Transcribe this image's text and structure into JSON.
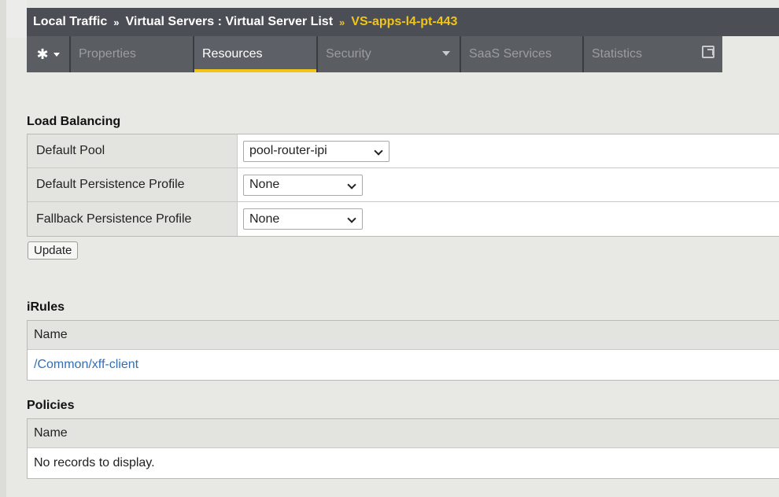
{
  "breadcrumb": {
    "level1": "Local Traffic",
    "level2": "Virtual Servers : Virtual Server List",
    "current": "VS-apps-l4-pt-443",
    "separator": "»"
  },
  "tabs": [
    {
      "label": "Properties"
    },
    {
      "label": "Resources",
      "active": true
    },
    {
      "label": "Security"
    },
    {
      "label": "SaaS Services"
    },
    {
      "label": "Statistics"
    }
  ],
  "load_balancing": {
    "title": "Load Balancing",
    "rows": [
      {
        "label": "Default Pool",
        "value": "pool-router-ipi"
      },
      {
        "label": "Default Persistence Profile",
        "value": "None"
      },
      {
        "label": "Fallback Persistence Profile",
        "value": "None"
      }
    ],
    "update_label": "Update"
  },
  "irules": {
    "title": "iRules",
    "column": "Name",
    "items": [
      "/Common/xff-client"
    ]
  },
  "policies": {
    "title": "Policies",
    "column": "Name",
    "empty_text": "No records to display."
  },
  "colors": {
    "accent": "#f0c419",
    "header_bg": "#4b4e54",
    "link": "#2f6fb8"
  }
}
